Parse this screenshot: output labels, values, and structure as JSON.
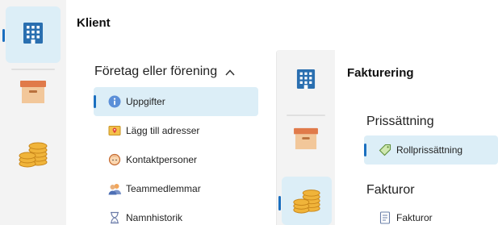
{
  "klient_window": {
    "title": "Klient",
    "group": {
      "label": "Företag eller förening",
      "chevron": "chevron-up-icon",
      "expanded": true
    },
    "items": [
      {
        "label": "Uppgifter",
        "icon": "info-icon",
        "selected": true
      },
      {
        "label": "Lägg till adresser",
        "icon": "address-card-icon",
        "selected": false
      },
      {
        "label": "Kontaktpersoner",
        "icon": "person-icon",
        "selected": false
      },
      {
        "label": "Teammedlemmar",
        "icon": "team-icon",
        "selected": false
      },
      {
        "label": "Namnhistorik",
        "icon": "hourglass-icon",
        "selected": false
      }
    ],
    "rail": [
      {
        "icon": "building-icon",
        "selected": true
      },
      {
        "icon": "archive-box-icon",
        "selected": false
      },
      {
        "icon": "coins-icon",
        "selected": false
      }
    ]
  },
  "fakturering_window": {
    "title": "Fakturering",
    "groups": [
      {
        "label": "Prissättning",
        "items": [
          {
            "label": "Rollprissättning",
            "icon": "price-tag-icon",
            "selected": true
          }
        ]
      },
      {
        "label": "Fakturor",
        "items": [
          {
            "label": "Fakturor",
            "icon": "document-icon",
            "selected": false
          }
        ]
      }
    ],
    "rail": [
      {
        "icon": "building-icon",
        "selected": false
      },
      {
        "icon": "archive-box-icon",
        "selected": false
      },
      {
        "icon": "coins-icon",
        "selected": true
      }
    ]
  },
  "colors": {
    "accent": "#1a6fc0",
    "selection": "#dceef7",
    "rail": "#f3f3f3"
  }
}
